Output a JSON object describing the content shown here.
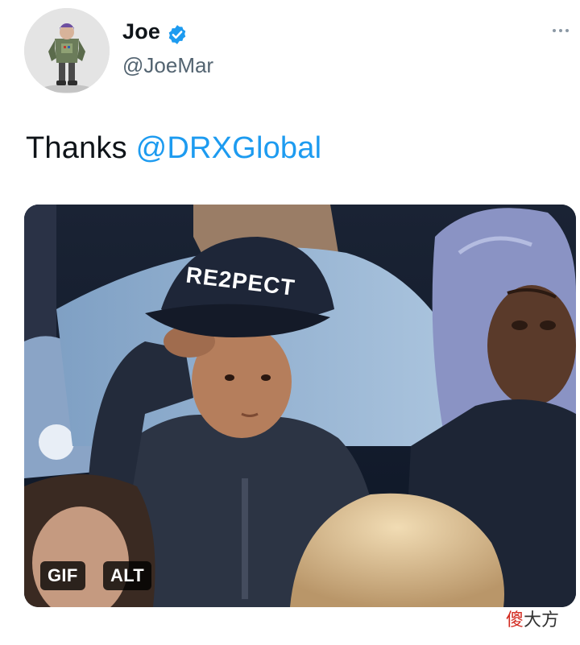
{
  "author": {
    "display_name": "Joe",
    "handle": "@JoeMar",
    "verified": true,
    "avatar_icon": "figure-avatar-icon"
  },
  "tweet": {
    "text_prefix": "Thanks ",
    "mention": "@DRXGlobal"
  },
  "media": {
    "cap_text": "RE2PECT",
    "badges": {
      "gif": "GIF",
      "alt": "ALT"
    }
  },
  "more_icon": "more-options-icon",
  "watermark": {
    "first": "傻",
    "rest": "大方"
  },
  "colors": {
    "mention": "#1d9bf0",
    "verified": "#1d9bf0",
    "handle": "#536471",
    "watermark_accent": "#d2281e"
  }
}
